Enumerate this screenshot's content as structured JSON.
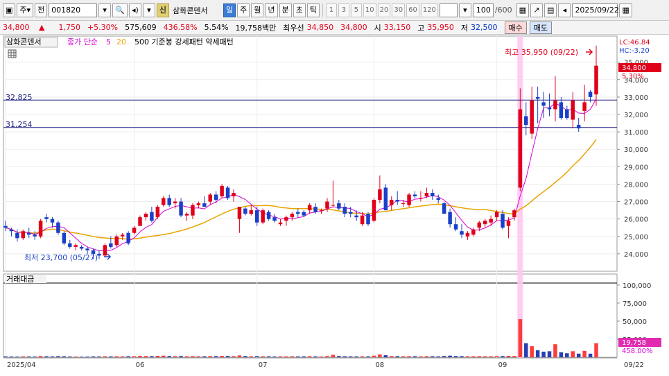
{
  "toolbar": {
    "type_label": "주",
    "market_label": "전",
    "code": "001820",
    "tag": "신",
    "name": "삼화콘덴서",
    "period_tabs": [
      "일",
      "주",
      "월",
      "년",
      "분",
      "초",
      "틱"
    ],
    "selected_period": "일",
    "interval_buttons": [
      "1",
      "3",
      "5",
      "10",
      "20",
      "30",
      "60",
      "120"
    ],
    "count": "100",
    "count_max": "/600",
    "date": "2025/09/22"
  },
  "quote": {
    "price": "34,800",
    "arrow": "▲",
    "change": "1,750",
    "change_pct": "+5.30%",
    "volume": "575,609",
    "volume_ratio": "436.58%",
    "turnover": "5.54%",
    "amount": "19,758백만",
    "best_label": "최우선",
    "best_ask": "34,850",
    "best_bid": "34,800",
    "open_label": "시",
    "open": "33,150",
    "high_label": "고",
    "high": "35,950",
    "low_label": "저",
    "low": "32,500",
    "buy_label": "매수",
    "sell_label": "매도"
  },
  "chart_header": {
    "name": "삼화콘덴서",
    "ma_label": "종가 단순",
    "ma_fast": "5",
    "ma_slow": "20",
    "extra": "500 기준봉 강세패턴 약세패턴"
  },
  "annotations": {
    "high_text": "최고 35,950 (09/22)",
    "low_text": "최저 23,700 (05/27)",
    "line1_label": "32,825",
    "line2_label": "31,254",
    "lc": "LC:46.84",
    "hc": "HC:-3.20",
    "current_price": "34,800",
    "current_pct": "5.30%",
    "vol_label": "거래대금",
    "vol_current": "19,758",
    "vol_pct": "458.00%"
  },
  "colors": {
    "up": "#e0001a",
    "down": "#1a3fc8",
    "ma5": "#d400d4",
    "ma20": "#e8a400",
    "highlight": "#ffc8f0"
  },
  "chart_data": {
    "type": "candlestick",
    "ylim": [
      23000,
      36500
    ],
    "yticks": [
      "35,000",
      "34,000",
      "33,000",
      "32,000",
      "31,000",
      "30,000",
      "29,000",
      "28,000",
      "27,000",
      "26,000",
      "25,000",
      "24,000"
    ],
    "vol_ticks": [
      "100,000",
      "75,000",
      "50,000",
      "25,000"
    ],
    "x_labels": [
      "2025/04",
      "06",
      "07",
      "08",
      "09",
      "09/22"
    ],
    "hlines": [
      32825,
      31254
    ],
    "ohlc": [
      [
        25600,
        25900,
        25300,
        25500
      ],
      [
        25400,
        25500,
        25000,
        25300
      ],
      [
        25200,
        25400,
        24700,
        24900
      ],
      [
        24900,
        25400,
        24800,
        25300
      ],
      [
        25200,
        25500,
        24900,
        25100
      ],
      [
        25100,
        25300,
        24800,
        25000
      ],
      [
        25000,
        26000,
        24900,
        25900
      ],
      [
        26100,
        26300,
        25800,
        26000
      ],
      [
        26000,
        26100,
        25500,
        25800
      ],
      [
        25800,
        25900,
        25100,
        25200
      ],
      [
        25200,
        25300,
        24500,
        24600
      ],
      [
        24600,
        24800,
        24300,
        24400
      ],
      [
        24400,
        24600,
        24200,
        24500
      ],
      [
        24400,
        24500,
        24200,
        24300
      ],
      [
        24300,
        24400,
        24000,
        24200
      ],
      [
        24200,
        24300,
        23700,
        24000
      ],
      [
        24000,
        24200,
        23700,
        23900
      ],
      [
        23900,
        24600,
        23800,
        24500
      ],
      [
        24600,
        25000,
        24300,
        24400
      ],
      [
        24500,
        25100,
        24400,
        25000
      ],
      [
        25000,
        25200,
        24800,
        25100
      ],
      [
        25200,
        25300,
        24500,
        24600
      ],
      [
        25200,
        25600,
        25100,
        25500
      ],
      [
        25600,
        26200,
        25600,
        26100
      ],
      [
        26100,
        26400,
        25900,
        26300
      ],
      [
        26400,
        26700,
        25800,
        25900
      ],
      [
        26100,
        26800,
        26000,
        26700
      ],
      [
        26800,
        27300,
        26700,
        27200
      ],
      [
        27200,
        27400,
        26700,
        26800
      ],
      [
        26900,
        27200,
        26600,
        27000
      ],
      [
        27000,
        27200,
        26100,
        26200
      ],
      [
        26200,
        26400,
        25900,
        26300
      ],
      [
        26200,
        26900,
        26000,
        26800
      ],
      [
        26800,
        27000,
        26600,
        26900
      ],
      [
        26900,
        27300,
        26700,
        26700
      ],
      [
        27000,
        27500,
        26800,
        27400
      ],
      [
        27400,
        27600,
        26900,
        27100
      ],
      [
        27300,
        28000,
        27200,
        27900
      ],
      [
        27800,
        27900,
        27100,
        27200
      ],
      [
        27300,
        27700,
        27000,
        27500
      ],
      [
        26000,
        26700,
        25200,
        26700
      ],
      [
        26600,
        26700,
        26200,
        26300
      ],
      [
        26300,
        26800,
        26200,
        26500
      ],
      [
        26500,
        26700,
        25600,
        25800
      ],
      [
        25800,
        26600,
        25700,
        26500
      ],
      [
        26400,
        26500,
        25900,
        26000
      ],
      [
        26100,
        26300,
        25800,
        25900
      ],
      [
        25700,
        26000,
        25600,
        25800
      ],
      [
        25900,
        26200,
        25600,
        26100
      ],
      [
        26100,
        26400,
        25900,
        26300
      ],
      [
        26400,
        26600,
        26100,
        26300
      ],
      [
        26400,
        26500,
        26100,
        26200
      ],
      [
        26500,
        26900,
        26300,
        26800
      ],
      [
        26700,
        26900,
        26300,
        26400
      ],
      [
        26500,
        26600,
        26300,
        26500
      ],
      [
        26600,
        27200,
        26400,
        27000
      ],
      [
        26800,
        28200,
        26700,
        26800
      ],
      [
        26900,
        27100,
        26500,
        26600
      ],
      [
        26700,
        26900,
        26100,
        26300
      ],
      [
        26400,
        26700,
        26100,
        26300
      ],
      [
        26200,
        26500,
        25900,
        26100
      ],
      [
        25700,
        26400,
        25600,
        26200
      ],
      [
        26300,
        26400,
        25600,
        25700
      ],
      [
        25900,
        27200,
        25800,
        27100
      ],
      [
        27100,
        28500,
        26900,
        27700
      ],
      [
        27800,
        28000,
        26500,
        26500
      ],
      [
        26800,
        27300,
        26500,
        27100
      ],
      [
        27100,
        27600,
        26800,
        27000
      ],
      [
        26900,
        27100,
        26700,
        26900
      ],
      [
        26800,
        27500,
        26700,
        27400
      ],
      [
        27400,
        27600,
        27200,
        27300
      ],
      [
        27200,
        27600,
        27000,
        27200
      ],
      [
        27300,
        27800,
        27200,
        27500
      ],
      [
        27500,
        27700,
        27100,
        27300
      ],
      [
        27200,
        27400,
        26900,
        27100
      ],
      [
        26900,
        27000,
        26300,
        26300
      ],
      [
        26400,
        26600,
        25500,
        25700
      ],
      [
        25700,
        26100,
        25300,
        25400
      ],
      [
        25300,
        25700,
        24900,
        25100
      ],
      [
        25000,
        25300,
        24800,
        25200
      ],
      [
        25100,
        25500,
        25000,
        25400
      ],
      [
        25500,
        25900,
        25300,
        25800
      ],
      [
        25700,
        26000,
        25500,
        25900
      ],
      [
        25800,
        26200,
        25600,
        26000
      ],
      [
        26100,
        26500,
        25900,
        26400
      ],
      [
        26300,
        26500,
        25400,
        25500
      ],
      [
        25600,
        26100,
        24900,
        25900
      ],
      [
        26100,
        26600,
        25900,
        26500
      ],
      [
        27800,
        33500,
        27600,
        32300
      ],
      [
        31900,
        32700,
        30800,
        31400
      ],
      [
        30900,
        33600,
        30600,
        32800
      ],
      [
        33000,
        33600,
        31500,
        32900
      ],
      [
        32700,
        33300,
        31800,
        32500
      ],
      [
        32400,
        33200,
        31900,
        32300
      ],
      [
        32300,
        34200,
        31600,
        32800
      ],
      [
        32700,
        33000,
        31700,
        31800
      ],
      [
        32300,
        32500,
        31700,
        31800
      ],
      [
        31700,
        33300,
        31200,
        32800
      ],
      [
        31400,
        31800,
        31000,
        31200
      ],
      [
        32200,
        33700,
        31600,
        32700
      ],
      [
        33300,
        33400,
        32700,
        33000
      ],
      [
        33150,
        35950,
        32500,
        34800
      ]
    ],
    "volume": [
      0.45,
      0.4,
      0.35,
      0.45,
      0.4,
      0.35,
      0.6,
      0.5,
      0.45,
      0.55,
      0.5,
      0.4,
      0.35,
      0.3,
      0.35,
      0.45,
      0.4,
      0.5,
      0.45,
      0.5,
      0.45,
      0.5,
      0.55,
      0.7,
      0.6,
      0.55,
      0.7,
      0.8,
      0.6,
      0.55,
      0.6,
      0.5,
      0.55,
      0.5,
      0.5,
      0.6,
      0.55,
      0.7,
      0.6,
      0.55,
      0.9,
      0.6,
      0.5,
      0.55,
      0.5,
      0.45,
      0.4,
      0.45,
      0.45,
      0.5,
      0.45,
      0.45,
      0.55,
      0.45,
      0.4,
      0.6,
      1.2,
      0.6,
      0.5,
      0.45,
      0.45,
      0.5,
      0.45,
      0.8,
      1.4,
      1.0,
      0.6,
      0.55,
      0.5,
      0.55,
      0.5,
      0.45,
      0.55,
      0.5,
      0.45,
      0.6,
      0.8,
      0.6,
      0.55,
      0.5,
      0.5,
      0.55,
      0.5,
      0.5,
      0.55,
      0.6,
      0.7,
      0.6,
      19.0,
      7.0,
      5.5,
      3.5,
      2.8,
      3.0,
      6.5,
      2.5,
      2.0,
      3.0,
      1.8,
      3.2,
      1.8,
      7.0
    ]
  }
}
